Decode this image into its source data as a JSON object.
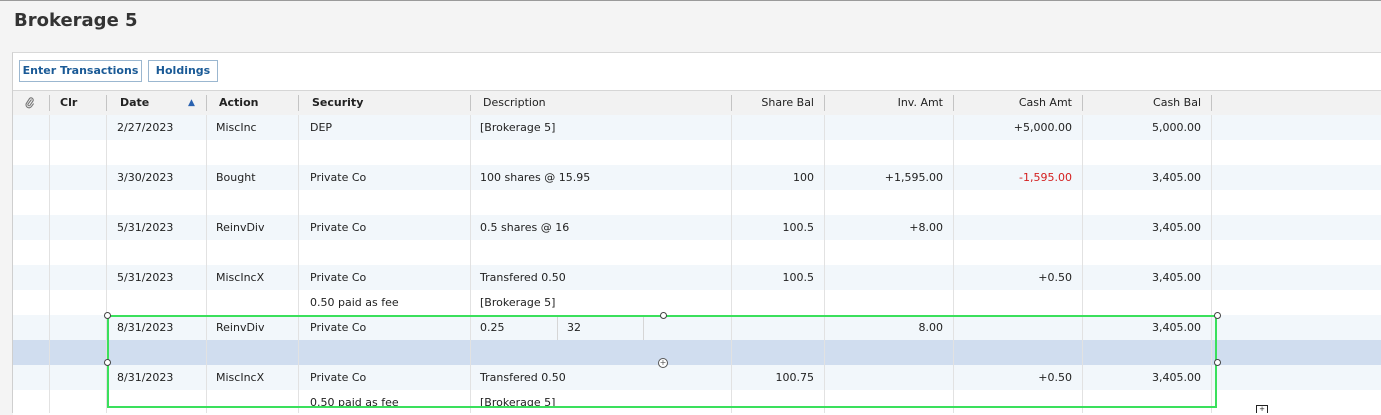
{
  "window": {
    "title": "Brokerage 5"
  },
  "toolbar": {
    "enter_transactions": "Enter Transactions",
    "holdings": "Holdings"
  },
  "columns": {
    "attach": "",
    "clr": "Clr",
    "date": "Date",
    "action": "Action",
    "security": "Security",
    "description": "Description",
    "share_bal": "Share Bal",
    "inv_amt": "Inv. Amt",
    "cash_amt": "Cash Amt",
    "cash_bal": "Cash Bal"
  },
  "sort": {
    "column": "Date",
    "direction": "ascending"
  },
  "colors": {
    "accent": "#1a5a96",
    "negative": "#d42020",
    "edit_outline": "#3ae05c",
    "selected_row": "#d0ddef"
  },
  "rows": [
    {
      "date": "2/27/2023",
      "action": "MiscInc",
      "security": "DEP",
      "description": "[Brokerage 5]",
      "share_bal": "",
      "inv_amt": "",
      "cash_amt": "+5,000.00",
      "cash_bal": "5,000.00"
    },
    {
      "date": "",
      "action": "",
      "security": "",
      "description": "",
      "share_bal": "",
      "inv_amt": "",
      "cash_amt": "",
      "cash_bal": ""
    },
    {
      "date": "3/30/2023",
      "action": "Bought",
      "security": "Private Co",
      "description": "100 shares @ 15.95",
      "share_bal": "100",
      "inv_amt": "+1,595.00",
      "cash_amt": "-1,595.00",
      "cash_bal": "3,405.00"
    },
    {
      "date": "",
      "action": "",
      "security": "",
      "description": "",
      "share_bal": "",
      "inv_amt": "",
      "cash_amt": "",
      "cash_bal": ""
    },
    {
      "date": "5/31/2023",
      "action": "ReinvDiv",
      "security": "Private Co",
      "description": "0.5 shares @ 16",
      "share_bal": "100.5",
      "inv_amt": "+8.00",
      "cash_amt": "",
      "cash_bal": "3,405.00"
    },
    {
      "date": "",
      "action": "",
      "security": "",
      "description": "",
      "share_bal": "",
      "inv_amt": "",
      "cash_amt": "",
      "cash_bal": ""
    },
    {
      "date": "5/31/2023",
      "action": "MiscIncX",
      "security": "Private Co",
      "description": "Transfered 0.50",
      "share_bal": "100.5",
      "inv_amt": "",
      "cash_amt": "+0.50",
      "cash_bal": "3,405.00"
    },
    {
      "date": "",
      "action": "",
      "security": "0.50 paid as fee",
      "description": "[Brokerage 5]",
      "share_bal": "",
      "inv_amt": "",
      "cash_amt": "",
      "cash_bal": ""
    },
    {
      "date": "8/31/2023",
      "action": "ReinvDiv",
      "security": "Private Co",
      "description": "0.25",
      "description_extra": "32",
      "share_bal": "",
      "inv_amt": "8.00",
      "cash_amt": "",
      "cash_bal": "3,405.00"
    },
    {
      "date": "",
      "action": "",
      "security": "",
      "description": "",
      "share_bal": "",
      "inv_amt": "",
      "cash_amt": "",
      "cash_bal": ""
    },
    {
      "date": "8/31/2023",
      "action": "MiscIncX",
      "security": "Private Co",
      "description": "Transfered 0.50",
      "share_bal": "100.75",
      "inv_amt": "",
      "cash_amt": "+0.50",
      "cash_bal": "3,405.00"
    },
    {
      "date": "",
      "action": "",
      "security": "0.50 paid as fee",
      "description": "[Brokerage 5]",
      "share_bal": "",
      "inv_amt": "",
      "cash_amt": "",
      "cash_bal": ""
    }
  ]
}
